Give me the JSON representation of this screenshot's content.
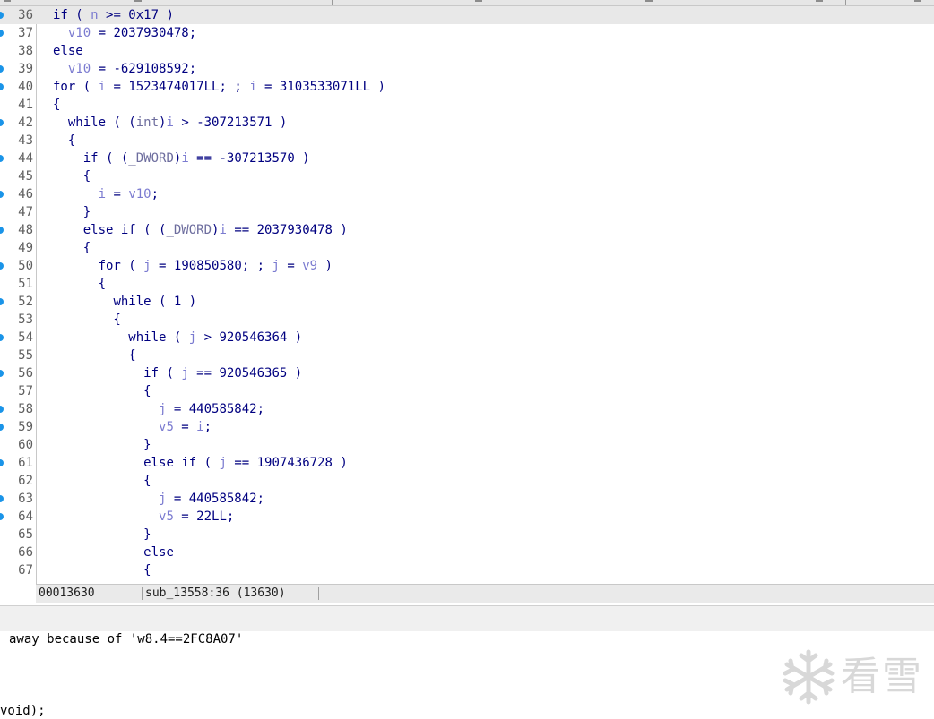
{
  "editor": {
    "lines": [
      {
        "n": "36",
        "bp": true,
        "current": true,
        "text": "if ( n >= 0x17 )"
      },
      {
        "n": "37",
        "bp": true,
        "current": false,
        "text": "  v10 = 2037930478;"
      },
      {
        "n": "38",
        "bp": false,
        "current": false,
        "text": "else"
      },
      {
        "n": "39",
        "bp": true,
        "current": false,
        "text": "  v10 = -629108592;"
      },
      {
        "n": "40",
        "bp": true,
        "current": false,
        "text": "for ( i = 1523474017LL; ; i = 3103533071LL )"
      },
      {
        "n": "41",
        "bp": false,
        "current": false,
        "text": "{"
      },
      {
        "n": "42",
        "bp": true,
        "current": false,
        "text": "  while ( (int)i > -307213571 )"
      },
      {
        "n": "43",
        "bp": false,
        "current": false,
        "text": "  {"
      },
      {
        "n": "44",
        "bp": true,
        "current": false,
        "text": "    if ( (_DWORD)i == -307213570 )"
      },
      {
        "n": "45",
        "bp": false,
        "current": false,
        "text": "    {"
      },
      {
        "n": "46",
        "bp": true,
        "current": false,
        "text": "      i = v10;"
      },
      {
        "n": "47",
        "bp": false,
        "current": false,
        "text": "    }"
      },
      {
        "n": "48",
        "bp": true,
        "current": false,
        "text": "    else if ( (_DWORD)i == 2037930478 )"
      },
      {
        "n": "49",
        "bp": false,
        "current": false,
        "text": "    {"
      },
      {
        "n": "50",
        "bp": true,
        "current": false,
        "text": "      for ( j = 190850580; ; j = v9 )"
      },
      {
        "n": "51",
        "bp": false,
        "current": false,
        "text": "      {"
      },
      {
        "n": "52",
        "bp": true,
        "current": false,
        "text": "        while ( 1 )"
      },
      {
        "n": "53",
        "bp": false,
        "current": false,
        "text": "        {"
      },
      {
        "n": "54",
        "bp": true,
        "current": false,
        "text": "          while ( j > 920546364 )"
      },
      {
        "n": "55",
        "bp": false,
        "current": false,
        "text": "          {"
      },
      {
        "n": "56",
        "bp": true,
        "current": false,
        "text": "            if ( j == 920546365 )"
      },
      {
        "n": "57",
        "bp": false,
        "current": false,
        "text": "            {"
      },
      {
        "n": "58",
        "bp": true,
        "current": false,
        "text": "              j = 440585842;"
      },
      {
        "n": "59",
        "bp": true,
        "current": false,
        "text": "              v5 = i;"
      },
      {
        "n": "60",
        "bp": false,
        "current": false,
        "text": "            }"
      },
      {
        "n": "61",
        "bp": true,
        "current": false,
        "text": "            else if ( j == 1907436728 )"
      },
      {
        "n": "62",
        "bp": false,
        "current": false,
        "text": "            {"
      },
      {
        "n": "63",
        "bp": true,
        "current": false,
        "text": "              j = 440585842;"
      },
      {
        "n": "64",
        "bp": true,
        "current": false,
        "text": "              v5 = 22LL;"
      },
      {
        "n": "65",
        "bp": false,
        "current": false,
        "text": "            }"
      },
      {
        "n": "66",
        "bp": false,
        "current": false,
        "text": "            else"
      },
      {
        "n": "67",
        "bp": false,
        "current": false,
        "text": "            {"
      }
    ]
  },
  "status_bar": {
    "address": "00013630",
    "location": "sub_13558:36 (13630)"
  },
  "output": {
    "line1": "away because of 'w8.4==2FC8A07'",
    "line2": "void);"
  },
  "watermark": {
    "icon": "snowflake-icon",
    "text": "看雪"
  },
  "colors": {
    "breakpoint": "#1a94e8",
    "current_line": "#e8e8e8",
    "code_text": "#000080",
    "variable": "#7b7bd0"
  }
}
